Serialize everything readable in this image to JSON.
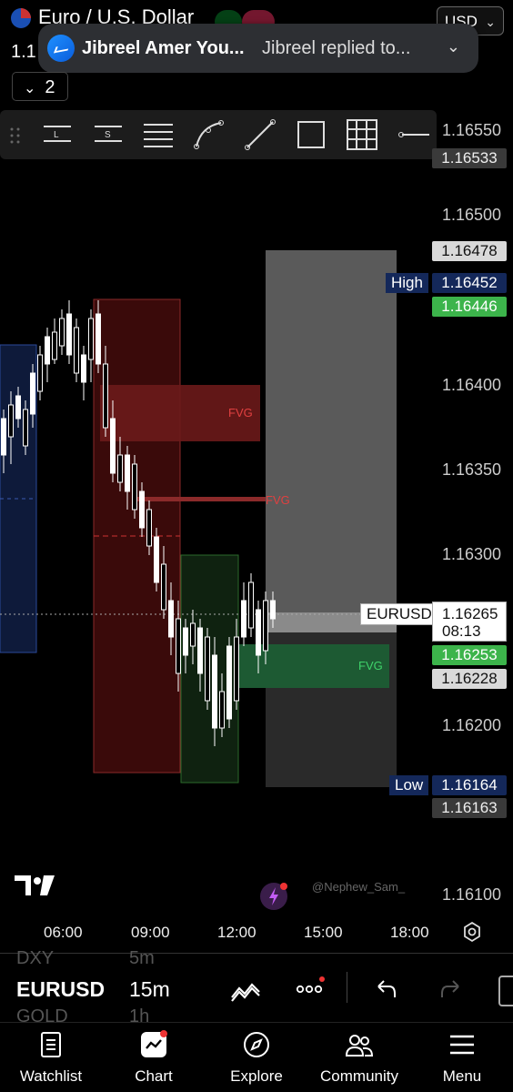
{
  "header": {
    "symbol_title": "Euro / U.S. Dollar",
    "price_stub": "1.1",
    "currency": "USD"
  },
  "notification": {
    "sender": "Jibreel Amer You...",
    "preview": "Jibreel replied to..."
  },
  "interval_selector": {
    "value": "2"
  },
  "drawing_tools": [
    "long-line-L-icon",
    "long-line-S-icon",
    "horizontal-lines-icon",
    "curve-icon",
    "trend-line-icon",
    "rectangle-icon",
    "grid-icon",
    "horizontal-ray-icon"
  ],
  "price_axis": {
    "ticks": [
      "1.16550",
      "1.16500",
      "1.16400",
      "1.16350",
      "1.16300",
      "1.16200",
      "1.16100"
    ],
    "tags": {
      "t1": "1.16533",
      "t2": "1.16478",
      "high_value": "1.16452",
      "t3": "1.16446",
      "current": "1.16265",
      "countdown": "08:13",
      "t4": "1.16253",
      "t5": "1.16228",
      "low_value": "1.16164",
      "t6": "1.16163"
    },
    "high_label": "High",
    "low_label": "Low",
    "symbol_tag": "EURUSD"
  },
  "chart": {
    "fvg_labels": [
      "FVG",
      "FVG",
      "FVG"
    ],
    "watermark": "@Nephew_Sam_",
    "colors": {
      "bull": "#ffffff",
      "bear": "#ffffff",
      "red_zone": "#8b1e1e",
      "green_zone": "#1f6b3a",
      "grey_zone": "#6b6b6b",
      "blue_zone": "#0e1a3a"
    }
  },
  "time_axis": {
    "labels": [
      "06:00",
      "09:00",
      "12:00",
      "15:00",
      "18:00"
    ]
  },
  "symbol_row": {
    "prev_symbol": "DXY",
    "prev_interval": "5m",
    "symbol": "EURUSD",
    "interval": "15m",
    "next_symbol": "GOLD",
    "next_interval": "1h"
  },
  "bottom_nav": [
    {
      "label": "Watchlist"
    },
    {
      "label": "Chart"
    },
    {
      "label": "Explore"
    },
    {
      "label": "Community"
    },
    {
      "label": "Menu"
    }
  ]
}
